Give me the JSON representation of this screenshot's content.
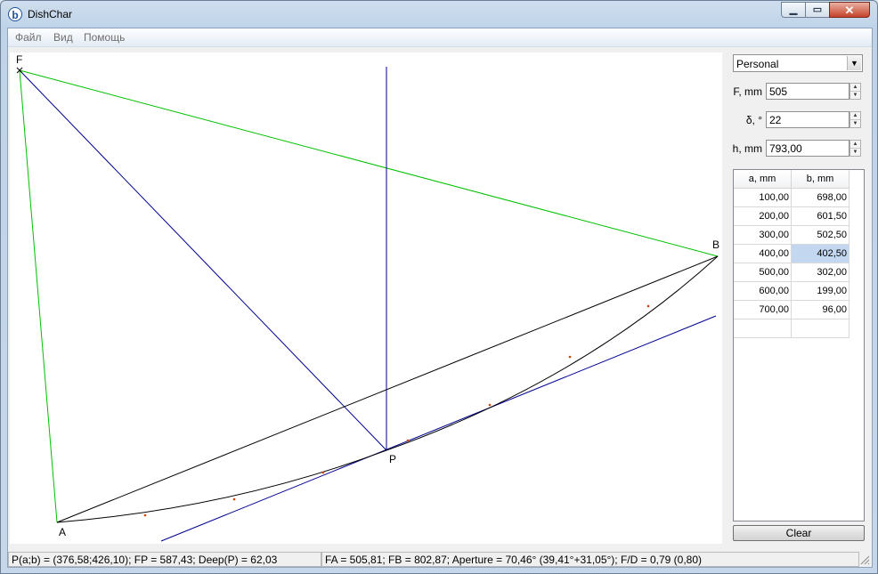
{
  "window": {
    "title": "DishChar",
    "app_icon_letter": "b"
  },
  "title_buttons": {
    "minimize": "▁",
    "maximize": "▭",
    "close": "✕"
  },
  "menu": {
    "items": [
      "Файл",
      "Вид",
      "Помощь"
    ]
  },
  "diagram": {
    "label_F": "F",
    "label_B": "B",
    "label_A": "A",
    "label_P": "P",
    "colors": {
      "green": "#00c000",
      "blue": "#000090",
      "black": "#000000",
      "marker": "#d04000"
    }
  },
  "side": {
    "profile_select": "Personal",
    "fields": [
      {
        "label": "F, mm",
        "value": "505"
      },
      {
        "label": "δ, °",
        "value": "22"
      },
      {
        "label": "h, mm",
        "value": "793,00"
      }
    ],
    "table": {
      "headers": [
        "a, mm",
        "b, mm"
      ],
      "rows": [
        [
          "100,00",
          "698,00"
        ],
        [
          "200,00",
          "601,50"
        ],
        [
          "300,00",
          "502,50"
        ],
        [
          "400,00",
          "402,50"
        ],
        [
          "500,00",
          "302,00"
        ],
        [
          "600,00",
          "199,00"
        ],
        [
          "700,00",
          "96,00"
        ],
        [
          "",
          ""
        ]
      ],
      "selected": {
        "row": 3,
        "col": 1
      }
    },
    "clear_label": "Clear"
  },
  "status": {
    "left": "P(a;b) = (376,58;426,10); FP = 587,43; Deep(P) = 62,03",
    "right": "FA = 505,81; FB = 802,87; Aperture = 70,46° (39,41°+31,05°); F/D = 0,79 (0,80)"
  }
}
